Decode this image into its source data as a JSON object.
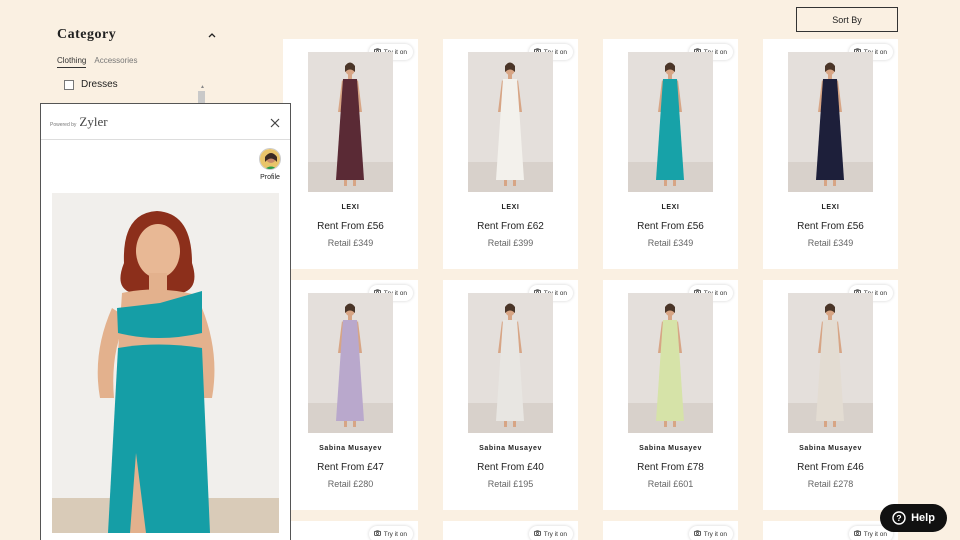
{
  "sidebar": {
    "title": "Category",
    "tabs": [
      {
        "label": "Clothing",
        "active": true
      },
      {
        "label": "Accessories",
        "active": false
      }
    ],
    "filters": [
      {
        "label": "Dresses",
        "checked": false
      }
    ]
  },
  "sort": {
    "label": "Sort By"
  },
  "try_on_label": "Try it on",
  "products": [
    {
      "brand": "LEXI",
      "rent": "Rent From £56",
      "retail": "Retail £349",
      "dress_color": "#5a2a35"
    },
    {
      "brand": "LEXI",
      "rent": "Rent From £62",
      "retail": "Retail £399",
      "dress_color": "#f3f1ec"
    },
    {
      "brand": "LEXI",
      "rent": "Rent From £56",
      "retail": "Retail £349",
      "dress_color": "#17a2a8"
    },
    {
      "brand": "LEXI",
      "rent": "Rent From £56",
      "retail": "Retail £349",
      "dress_color": "#1d1f3a"
    },
    {
      "brand": "Sabina Musayev",
      "rent": "Rent From £47",
      "retail": "Retail £280",
      "dress_color": "#b9a8cc"
    },
    {
      "brand": "Sabina Musayev",
      "rent": "Rent From £40",
      "retail": "Retail £195",
      "dress_color": "#e8e6e2"
    },
    {
      "brand": "Sabina Musayev",
      "rent": "Rent From £78",
      "retail": "Retail £601",
      "dress_color": "#d6e3a8"
    },
    {
      "brand": "Sabina Musayev",
      "rent": "Rent From £46",
      "retail": "Retail £278",
      "dress_color": "#e3dcd2"
    }
  ],
  "zyler": {
    "powered_by": "Powered by",
    "name": "Zyler",
    "profile_label": "Profile",
    "dress_color": "#159ea6",
    "hair_color": "#8c2f1b"
  },
  "help": {
    "label": "Help"
  },
  "colors": {
    "background": "#faf0e2",
    "card": "#ffffff",
    "help_bg": "#111111"
  }
}
